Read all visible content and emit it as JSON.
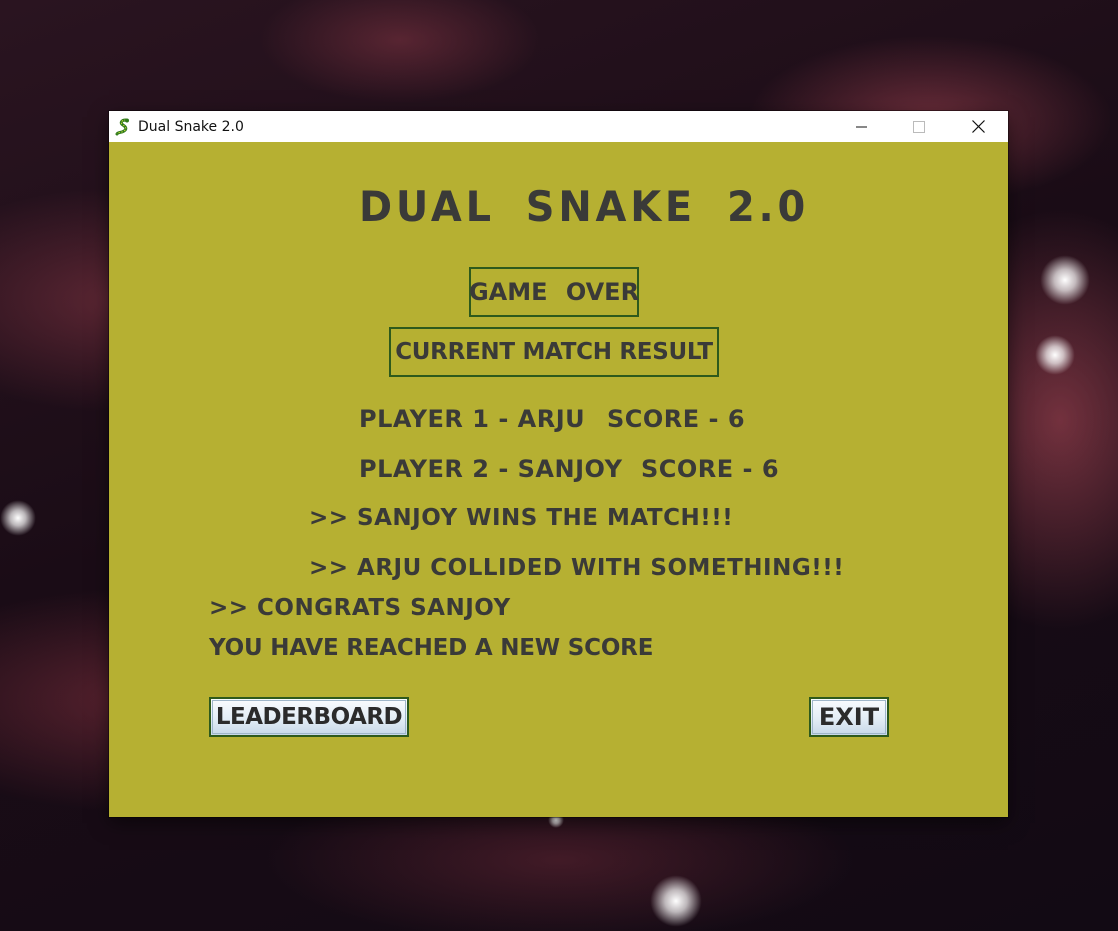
{
  "window": {
    "title": "Dual Snake 2.0"
  },
  "game": {
    "title": "DUAL   SNAKE   2.0",
    "status": "GAME   OVER",
    "result_heading": "CURRENT MATCH RESULT",
    "player1": {
      "label": "PLAYER 1 - ARJU",
      "score": "SCORE - 6"
    },
    "player2": {
      "label": "PLAYER 2 - SANJOY",
      "score": "SCORE - 6"
    },
    "winner_message": ">> SANJOY  WINS  THE  MATCH!!!",
    "collision_message": ">> ARJU  COLLIDED WITH SOMETHING!!!",
    "congrats_message": ">>  CONGRATS   SANJOY",
    "new_score_message": "YOU HAVE REACHED A NEW SCORE"
  },
  "buttons": {
    "leaderboard": "LEADERBOARD",
    "exit": "EXIT"
  },
  "colors": {
    "panel_background": "#b6b032",
    "text": "#3a3a38",
    "border": "#2e5a1c"
  },
  "icons": {
    "app": "snake-icon",
    "minimize": "minimize-icon",
    "maximize": "maximize-icon",
    "close": "close-icon"
  }
}
